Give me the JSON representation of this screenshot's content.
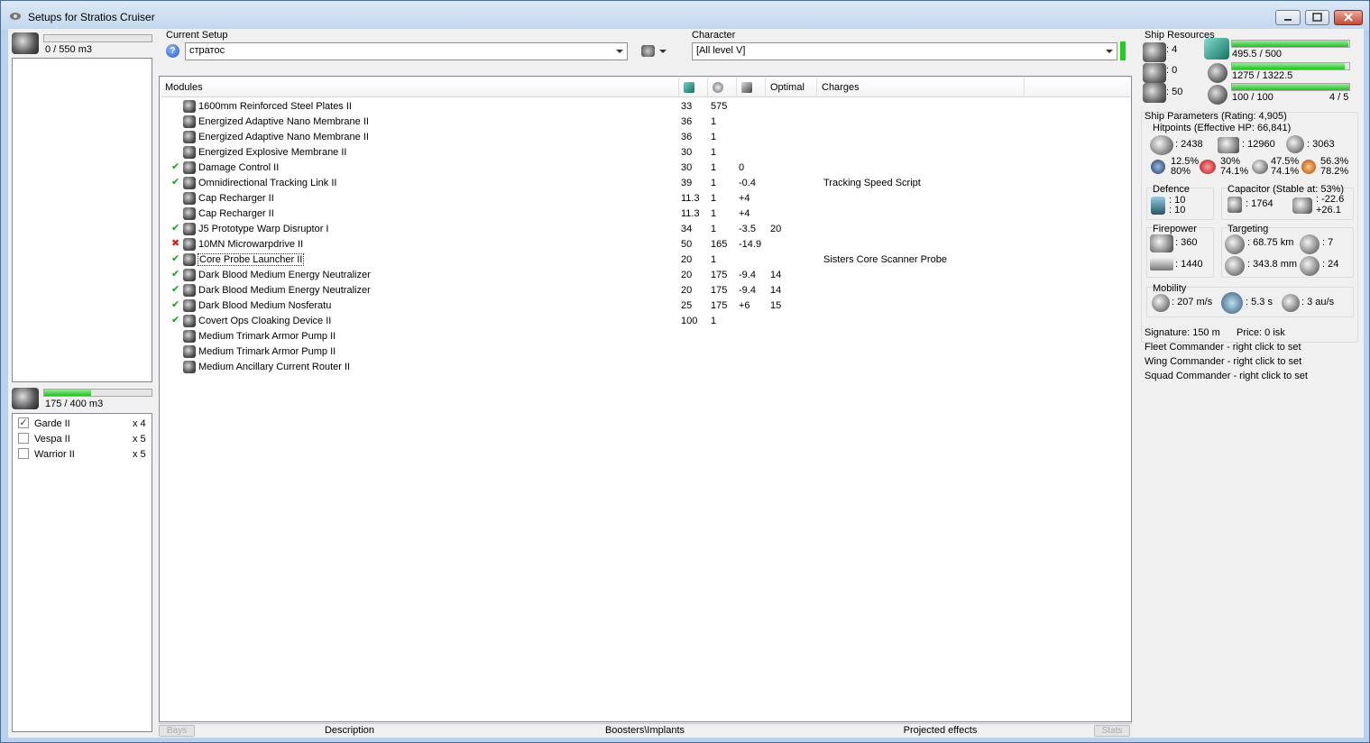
{
  "window": {
    "title": "Setups for Stratios Cruiser"
  },
  "cargo": {
    "value": "0 / 550 m3",
    "fill": 0.0
  },
  "drone_bay": {
    "value": "175 / 400 m3",
    "fill": 0.4375,
    "drones": [
      {
        "name": "Garde II",
        "count": "x 4",
        "checked": true
      },
      {
        "name": "Vespa II",
        "count": "x 5",
        "checked": false
      },
      {
        "name": "Warrior II",
        "count": "x 5",
        "checked": false
      }
    ]
  },
  "setup": {
    "label": "Current Setup",
    "value": "стратос",
    "help_icon": "?"
  },
  "character": {
    "label": "Character",
    "value": "[All level V]",
    "status_color": "#22cc22"
  },
  "modules": {
    "headers": [
      "Modules",
      "",
      "",
      "",
      "Optimal",
      "Charges"
    ],
    "rows": [
      {
        "status": "",
        "name": "1600mm Reinforced Steel Plates II",
        "cpu": "33",
        "pg": "575",
        "cap": "",
        "optimal": "",
        "charges": ""
      },
      {
        "status": "",
        "name": "Energized Adaptive Nano Membrane II",
        "cpu": "36",
        "pg": "1",
        "cap": "",
        "optimal": "",
        "charges": ""
      },
      {
        "status": "",
        "name": "Energized Adaptive Nano Membrane II",
        "cpu": "36",
        "pg": "1",
        "cap": "",
        "optimal": "",
        "charges": ""
      },
      {
        "status": "",
        "name": "Energized Explosive Membrane II",
        "cpu": "30",
        "pg": "1",
        "cap": "",
        "optimal": "",
        "charges": ""
      },
      {
        "status": "✔",
        "name": "Damage Control II",
        "cpu": "30",
        "pg": "1",
        "cap": "0",
        "optimal": "",
        "charges": ""
      },
      {
        "status": "✔",
        "name": "Omnidirectional Tracking Link II",
        "cpu": "39",
        "pg": "1",
        "cap": "-0.4",
        "optimal": "",
        "charges": "Tracking Speed Script"
      },
      {
        "status": "",
        "name": "Cap Recharger II",
        "cpu": "11.3",
        "pg": "1",
        "cap": "+4",
        "optimal": "",
        "charges": ""
      },
      {
        "status": "",
        "name": "Cap Recharger II",
        "cpu": "11.3",
        "pg": "1",
        "cap": "+4",
        "optimal": "",
        "charges": ""
      },
      {
        "status": "✔",
        "name": "J5 Prototype Warp Disruptor I",
        "cpu": "34",
        "pg": "1",
        "cap": "-3.5",
        "optimal": "20",
        "charges": ""
      },
      {
        "status": "✖",
        "name": "10MN Microwarpdrive II",
        "cpu": "50",
        "pg": "165",
        "cap": "-14.9",
        "optimal": "",
        "charges": ""
      },
      {
        "status": "✔",
        "name": "Core Probe Launcher II",
        "cpu": "20",
        "pg": "1",
        "cap": "",
        "optimal": "",
        "charges": "Sisters Core Scanner Probe"
      },
      {
        "status": "✔",
        "name": "Dark Blood Medium Energy Neutralizer",
        "cpu": "20",
        "pg": "175",
        "cap": "-9.4",
        "optimal": "14",
        "charges": ""
      },
      {
        "status": "✔",
        "name": "Dark Blood Medium Energy Neutralizer",
        "cpu": "20",
        "pg": "175",
        "cap": "-9.4",
        "optimal": "14",
        "charges": ""
      },
      {
        "status": "✔",
        "name": "Dark Blood Medium Nosferatu",
        "cpu": "25",
        "pg": "175",
        "cap": "+6",
        "optimal": "15",
        "charges": ""
      },
      {
        "status": "✔",
        "name": "Covert Ops Cloaking Device II",
        "cpu": "100",
        "pg": "1",
        "cap": "",
        "optimal": "",
        "charges": ""
      },
      {
        "status": "",
        "name": "Medium Trimark Armor Pump II",
        "cpu": "",
        "pg": "",
        "cap": "",
        "optimal": "",
        "charges": ""
      },
      {
        "status": "",
        "name": "Medium Trimark Armor Pump II",
        "cpu": "",
        "pg": "",
        "cap": "",
        "optimal": "",
        "charges": ""
      },
      {
        "status": "",
        "name": "Medium Ancillary Current Router II",
        "cpu": "",
        "pg": "",
        "cap": "",
        "optimal": "",
        "charges": ""
      }
    ]
  },
  "tabs": [
    "Bays",
    "Description",
    "Boosters\\Implants",
    "Projected effects",
    "Stats"
  ],
  "resources": {
    "label": "Ship Resources",
    "turrets": ": 4",
    "launchers": ": 0",
    "calibration": ": 50",
    "cpu": "495.5 / 500",
    "cpu_fill": 0.991,
    "powergrid": "1275 / 1322.5",
    "pg_fill": 0.964,
    "drone_bw": "100 / 100",
    "bw_fill": 1.0,
    "drone_count": "4 / 5"
  },
  "params": {
    "label": "Ship Parameters (Rating: 4,905)",
    "hitpoints": "Hitpoints (Effective HP: 66,841)",
    "shield": ": 2438",
    "armor": ": 12960",
    "structure": ": 3063",
    "res": [
      [
        "12.5%",
        "80%"
      ],
      [
        "30%",
        "74.1%"
      ],
      [
        "47.5%",
        "74.1%"
      ],
      [
        "56.3%",
        "78.2%"
      ]
    ],
    "defence": {
      "label": "Defence",
      "v1": ": 10",
      "v2": ": 10"
    },
    "capacitor": {
      "label": "Capacitor (Stable at: 53%)",
      "amount": ": 1764",
      "use": ": -22.6",
      "recharge": "+26.1"
    },
    "firepower": {
      "label": "Firepower",
      "turret": ": 360",
      "drone": ": 1440"
    },
    "targeting": {
      "label": "Targeting",
      "range": ": 68.75 km",
      "targets": ": 7",
      "scanres": ": 343.8 mm",
      "sensor": ": 24"
    },
    "mobility": {
      "label": "Mobility",
      "speed": ": 207 m/s",
      "align": ": 5.3 s",
      "warp": ": 3 au/s"
    },
    "signature": "Signature: 150 m",
    "price": "Price: 0 isk",
    "fleet": "Fleet Commander - right click to set",
    "wing": "Wing Commander - right click to set",
    "squad": "Squad Commander - right click to set"
  }
}
